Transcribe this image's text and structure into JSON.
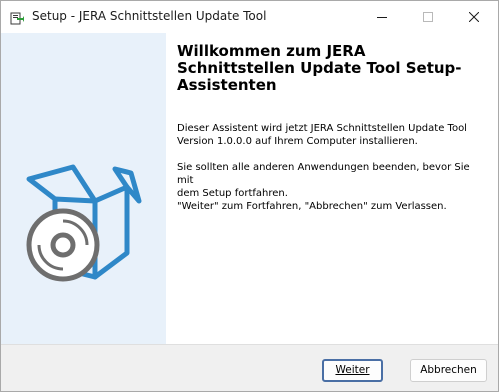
{
  "window": {
    "title": "Setup - JERA Schnittstellen Update Tool",
    "controls": {
      "minimize_icon": "minimize-icon",
      "maximize_icon": "maximize-icon",
      "close_icon": "close-icon"
    }
  },
  "content": {
    "heading": "Willkommen zum JERA Schnittstellen Update Tool Setup-Assistenten",
    "paragraph1": "Dieser Assistent wird jetzt JERA Schnittstellen Update Tool\nVersion 1.0.0.0 auf Ihrem Computer installieren.",
    "paragraph2": "Sie sollten alle anderen Anwendungen beenden, bevor Sie mit\ndem Setup fortfahren.",
    "paragraph3": "\"Weiter\" zum Fortfahren, \"Abbrechen\" zum Verlassen."
  },
  "buttons": {
    "next_label": "Weiter",
    "cancel_label": "Abbrechen"
  },
  "colors": {
    "sidebar_bg": "#e8f1fa",
    "illustration_blue": "#2f88c8",
    "disc_gray": "#6e6e6e"
  },
  "icons": {
    "app": "setup-app-icon",
    "illustration": "software-box-with-disc-icon"
  }
}
